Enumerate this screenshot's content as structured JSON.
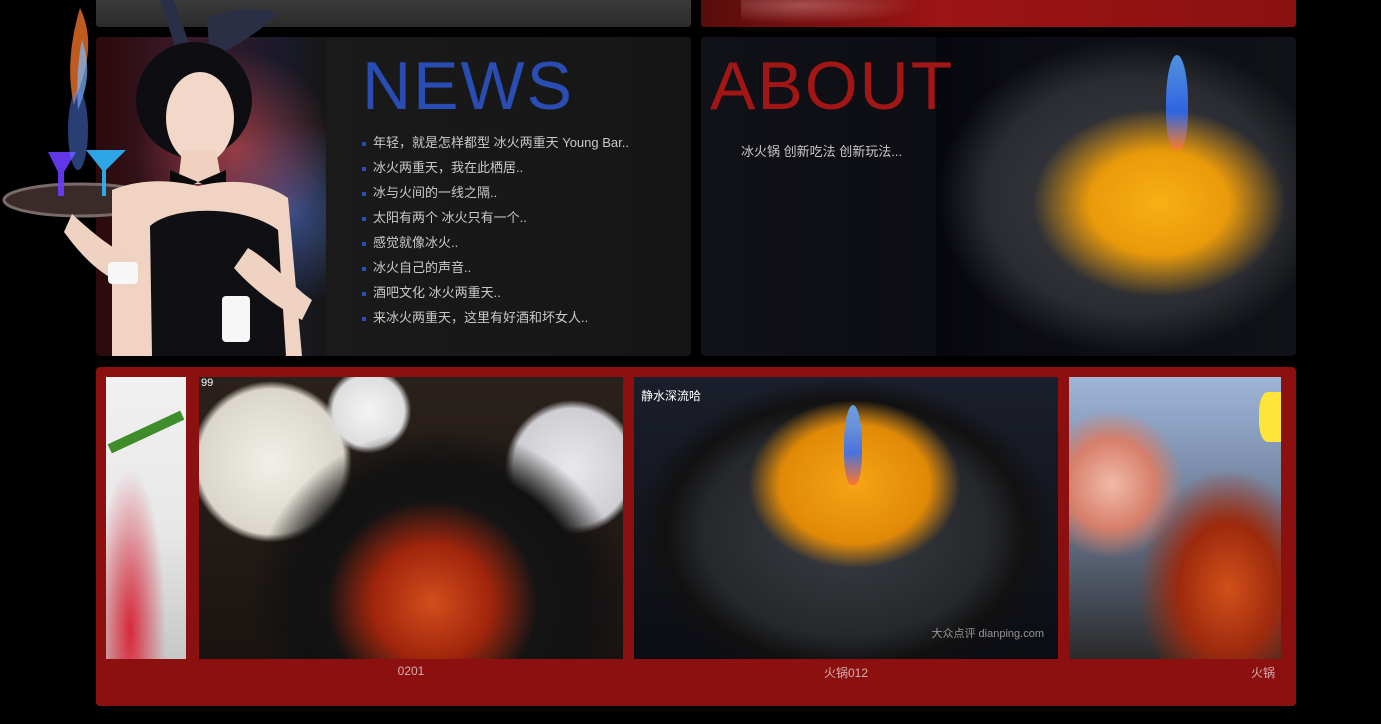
{
  "news": {
    "title": "NEWS",
    "items": [
      "年轻，就是怎样都型 冰火两重天 Young Bar..",
      "冰火两重天，我在此栖居..",
      "冰与火间的一线之隔..",
      "太阳有两个 冰火只有一个..",
      "感觉就像冰火..",
      "冰火自己的声音..",
      "酒吧文化 冰火两重天..",
      "来冰火两重天，这里有好酒和坏女人.."
    ]
  },
  "about": {
    "title": "ABOUT",
    "text": "冰火锅 创新吃法 创新玩法..."
  },
  "gallery": {
    "items": [
      {
        "caption": ""
      },
      {
        "caption": "0201",
        "overlay": "99"
      },
      {
        "caption": "火锅012",
        "overlay": "静水深流哈",
        "watermark": "大众点评 dianping.com"
      },
      {
        "caption": "火锅"
      }
    ]
  },
  "colors": {
    "news_blue": "#2a4db3",
    "about_red": "#a31616",
    "gallery_bg": "#8c1010"
  }
}
